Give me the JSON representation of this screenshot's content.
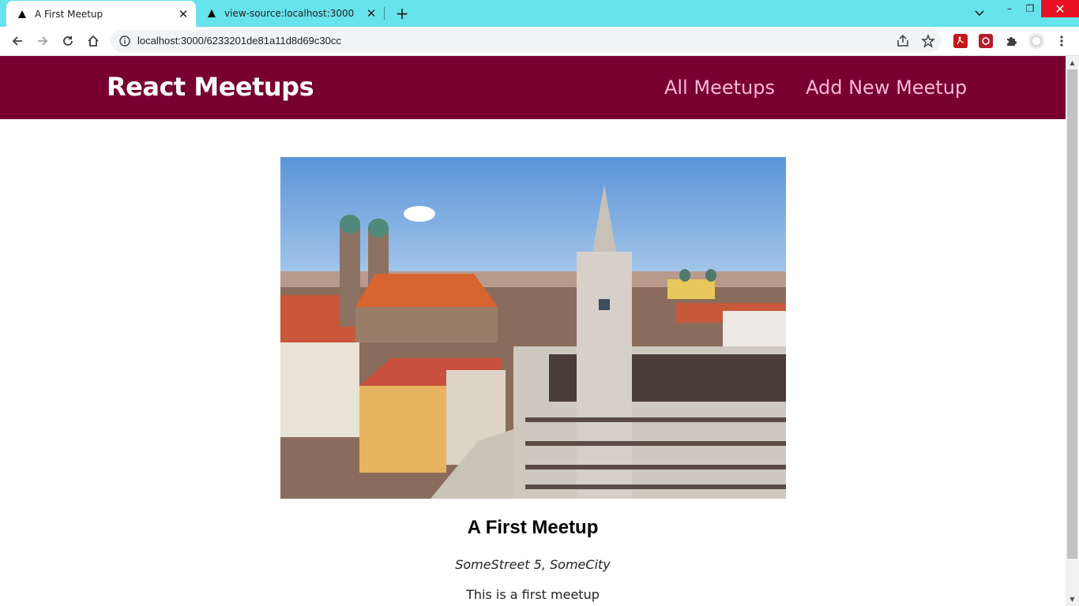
{
  "browser": {
    "tabs": [
      {
        "title": "A First Meetup",
        "active": true
      },
      {
        "title": "view-source:localhost:3000",
        "active": false
      }
    ],
    "url": "localhost:3000/6233201de81a11d8d69c30cc",
    "window_controls": {
      "minimize": "–",
      "maximize": "❐",
      "close": "✕"
    }
  },
  "header": {
    "logo": "React Meetups",
    "nav": [
      "All Meetups",
      "Add New Meetup"
    ]
  },
  "meetup": {
    "image_alt": "A First Meetup",
    "title": "A First Meetup",
    "address": "SomeStreet 5, SomeCity",
    "description": "This is a first meetup"
  },
  "colors": {
    "tabstrip": "#67e3ec",
    "header": "#77002e",
    "nav_link": "#fcb8d6"
  },
  "icons": [
    "back-icon",
    "forward-icon",
    "reload-icon",
    "home-icon",
    "info-icon",
    "share-icon",
    "star-icon",
    "pdf-extension-icon",
    "extension-icon",
    "puzzle-icon",
    "profile-icon",
    "menu-icon"
  ]
}
